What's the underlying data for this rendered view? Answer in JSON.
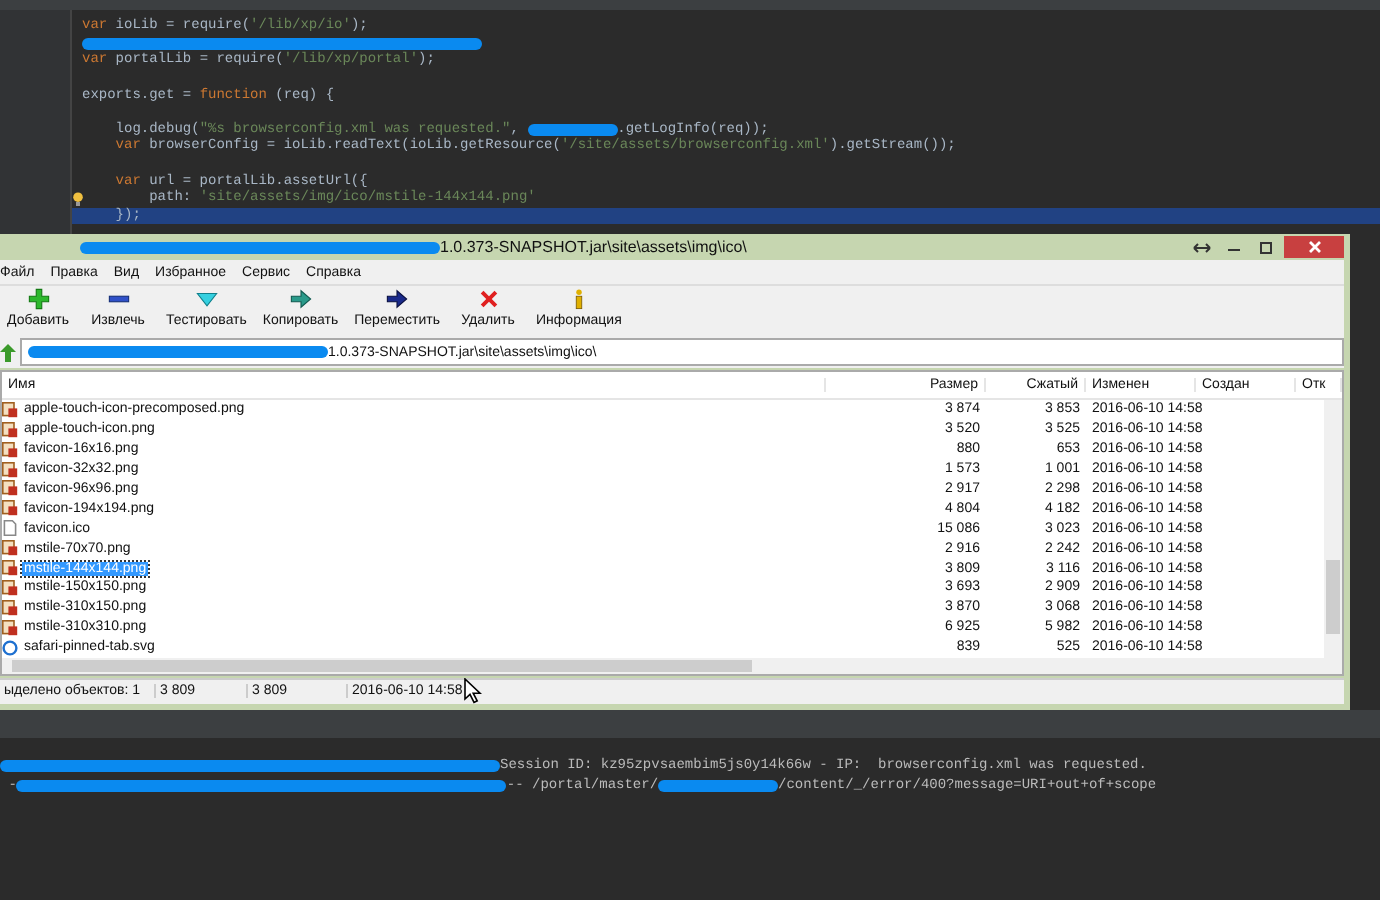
{
  "editor": {
    "lines": [
      {
        "kind": "code",
        "segments": [
          {
            "kind": "keyword",
            "text": "var"
          },
          {
            "kind": "plain",
            "text": " ioLib = require("
          },
          {
            "kind": "string",
            "text": "'/lib/xp/io'"
          },
          {
            "kind": "plain",
            "text": ");"
          }
        ]
      },
      {
        "kind": "code",
        "segments": [
          {
            "kind": "redaction"
          }
        ]
      },
      {
        "kind": "code",
        "segments": [
          {
            "kind": "keyword",
            "text": "var"
          },
          {
            "kind": "plain",
            "text": " portalLib = require("
          },
          {
            "kind": "string",
            "text": "'/lib/xp/portal'"
          },
          {
            "kind": "plain",
            "text": ");"
          }
        ]
      },
      {
        "kind": "blank"
      },
      {
        "kind": "code",
        "segments": [
          {
            "kind": "plain",
            "text": "exports.get = "
          },
          {
            "kind": "keyword",
            "text": "function"
          },
          {
            "kind": "plain",
            "text": " (req) {"
          }
        ]
      },
      {
        "kind": "blank"
      },
      {
        "kind": "code",
        "segments": [
          {
            "kind": "plain",
            "text": "    log.debug("
          },
          {
            "kind": "string",
            "text": "\"%s browserconfig.xml was requested.\""
          },
          {
            "kind": "plain",
            "text": ", "
          },
          {
            "kind": "redaction"
          },
          {
            "kind": "plain",
            "text": ".getLogInfo(req));"
          }
        ]
      },
      {
        "kind": "code",
        "segments": [
          {
            "kind": "keyword",
            "text": "    var"
          },
          {
            "kind": "plain",
            "text": " browserConfig = ioLib.readText(ioLib.getResource("
          },
          {
            "kind": "string",
            "text": "'/site/assets/browserconfig.xml'"
          },
          {
            "kind": "plain",
            "text": ").getStream());"
          }
        ]
      },
      {
        "kind": "blank"
      },
      {
        "kind": "code",
        "segments": [
          {
            "kind": "keyword",
            "text": "    var"
          },
          {
            "kind": "plain",
            "text": " url = portalLib.assetUrl({"
          }
        ]
      },
      {
        "kind": "code",
        "segments": [
          {
            "kind": "plain",
            "text": "        path: "
          },
          {
            "kind": "string",
            "text": "'site/assets/img/ico/mstile-144x144.png'"
          }
        ],
        "bulb": true
      },
      {
        "kind": "code",
        "segments": [
          {
            "kind": "plain",
            "text": "    });"
          }
        ],
        "current": true
      }
    ]
  },
  "window": {
    "title": [
      {
        "kind": "redaction"
      },
      {
        "kind": "plain",
        "text": "1.0.373-SNAPSHOT.jar\\site\\assets\\img\\ico\\"
      }
    ],
    "menu": [
      "Файл",
      "Правка",
      "Вид",
      "Избранное",
      "Сервис",
      "Справка"
    ],
    "toolbar": [
      {
        "kind": "add",
        "label": "Добавить"
      },
      {
        "kind": "extract",
        "label": "Извлечь"
      },
      {
        "kind": "test",
        "label": "Тестировать"
      },
      {
        "kind": "copy",
        "label": "Копировать"
      },
      {
        "kind": "move",
        "label": "Переместить"
      },
      {
        "kind": "delete",
        "label": "Удалить"
      },
      {
        "kind": "info",
        "label": "Информация"
      }
    ],
    "address": [
      {
        "kind": "redaction"
      },
      {
        "kind": "plain",
        "text": "1.0.373-SNAPSHOT.jar\\site\\assets\\img\\ico\\"
      }
    ],
    "columns": [
      "Имя",
      "Размер",
      "Сжатый",
      "Изменен",
      "Создан",
      "Отк"
    ],
    "rows": [
      {
        "kind": "image",
        "name": "apple-touch-icon-precomposed.png",
        "size": "3 874",
        "packed": "3 853",
        "modified": "2016-06-10 14:58",
        "selected": false
      },
      {
        "kind": "image",
        "name": "apple-touch-icon.png",
        "size": "3 520",
        "packed": "3 525",
        "modified": "2016-06-10 14:58",
        "selected": false
      },
      {
        "kind": "image",
        "name": "favicon-16x16.png",
        "size": "880",
        "packed": "653",
        "modified": "2016-06-10 14:58",
        "selected": false
      },
      {
        "kind": "image",
        "name": "favicon-32x32.png",
        "size": "1 573",
        "packed": "1 001",
        "modified": "2016-06-10 14:58",
        "selected": false
      },
      {
        "kind": "image",
        "name": "favicon-96x96.png",
        "size": "2 917",
        "packed": "2 298",
        "modified": "2016-06-10 14:58",
        "selected": false
      },
      {
        "kind": "image",
        "name": "favicon-194x194.png",
        "size": "4 804",
        "packed": "4 182",
        "modified": "2016-06-10 14:58",
        "selected": false
      },
      {
        "kind": "file",
        "name": "favicon.ico",
        "size": "15 086",
        "packed": "3 023",
        "modified": "2016-06-10 14:58",
        "selected": false
      },
      {
        "kind": "image",
        "name": "mstile-70x70.png",
        "size": "2 916",
        "packed": "2 242",
        "modified": "2016-06-10 14:58",
        "selected": false
      },
      {
        "kind": "image",
        "name": "mstile-144x144.png",
        "size": "3 809",
        "packed": "3 116",
        "modified": "2016-06-10 14:58",
        "selected": true
      },
      {
        "kind": "image",
        "name": "mstile-150x150.png",
        "size": "3 693",
        "packed": "2 909",
        "modified": "2016-06-10 14:58",
        "selected": false
      },
      {
        "kind": "image",
        "name": "mstile-310x150.png",
        "size": "3 870",
        "packed": "3 068",
        "modified": "2016-06-10 14:58",
        "selected": false
      },
      {
        "kind": "image",
        "name": "mstile-310x310.png",
        "size": "6 925",
        "packed": "5 982",
        "modified": "2016-06-10 14:58",
        "selected": false
      },
      {
        "kind": "web",
        "name": "safari-pinned-tab.svg",
        "size": "839",
        "packed": "525",
        "modified": "2016-06-10 14:58",
        "selected": false
      }
    ],
    "status": [
      "ыделено объектов: 1",
      "3 809",
      "3 809",
      "2016-06-10 14:58"
    ]
  },
  "console": {
    "lines": [
      [
        {
          "kind": "redaction"
        },
        {
          "kind": "plain",
          "text": "Session ID: kz95zpvsaembim5js0y14k66w - IP:  browserconfig.xml was requested."
        }
      ],
      [
        {
          "kind": "plain",
          "text": " -"
        },
        {
          "kind": "redaction"
        },
        {
          "kind": "plain",
          "text": "-- /portal/master/"
        },
        {
          "kind": "redaction"
        },
        {
          "kind": "plain",
          "text": "/content/_/error/400?message=URI+out+of+scope"
        }
      ]
    ]
  }
}
